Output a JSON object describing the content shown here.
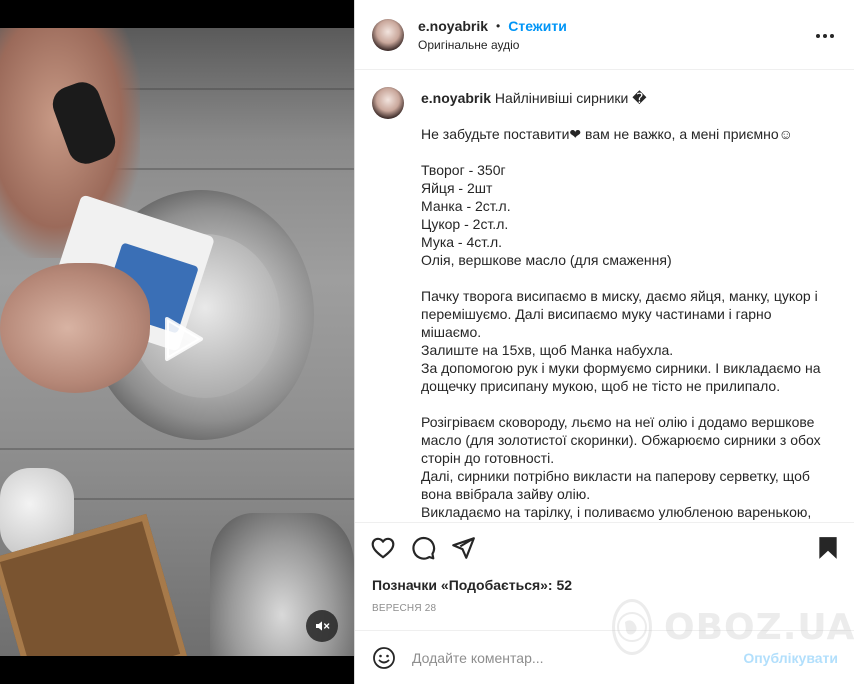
{
  "post": {
    "username": "e.noyabrik",
    "separator": "•",
    "follow_label": "Стежити",
    "audio_label": "Оригінальне аудіо"
  },
  "caption": {
    "username": "e.noyabrik",
    "title": "Найлінивіші сирники",
    "title_glyph": "�",
    "lines": [
      "",
      "Не забудьте поставити❤ вам не важко, а мені приємно☺",
      "",
      "Творог - 350г",
      "Яйця - 2шт",
      "Манка - 2ст.л.",
      "Цукор - 2ст.л.",
      "Мука - 4ст.л.",
      "Олія, вершкове масло (для смаження)",
      "",
      "Пачку творога висипаємо в миску, даємо яйця, манку, цукор і",
      "перемішуємо. Далі висипаємо муку частинами і гарно",
      "мішаємо.",
      "Залиште на 15хв, щоб Манка набухла.",
      "За допомогою рук і муки формуємо сирники. І викладаємо на",
      "дощечку присипану мукою, щоб не тісто не прилипало.",
      "",
      "Розігріваєм сковороду, льємо на неї олію і додамо вершкове",
      "масло (для золотистої скоринки). Обжарюємо сирники з обох",
      "сторін до готовності.",
      "Далі, сирники потрібно викласти на паперову серветку, щоб",
      "вона ввібрала зайву олію.",
      "Викладаємо на тарілку, і поливаємо улюбленою варенькою,"
    ]
  },
  "engagement": {
    "likes_label": "Позначки «Подобається»: 52",
    "date": "ВЕРЕСНЯ 28"
  },
  "comment_box": {
    "placeholder": "Додайте коментар...",
    "publish_label": "Опублікувати"
  },
  "watermark": {
    "text": "OBOZ.UA"
  },
  "icons": {
    "more": "more-horizontal-icon",
    "like": "heart-icon",
    "comment": "comment-icon",
    "share": "send-icon",
    "save": "bookmark-icon",
    "emoji": "emoji-icon",
    "play": "play-icon",
    "mute": "muted-speaker-icon"
  },
  "colors": {
    "accent": "#0095f6",
    "publish_disabled": "#b2dffc",
    "secondary_text": "#8e8e8e"
  }
}
